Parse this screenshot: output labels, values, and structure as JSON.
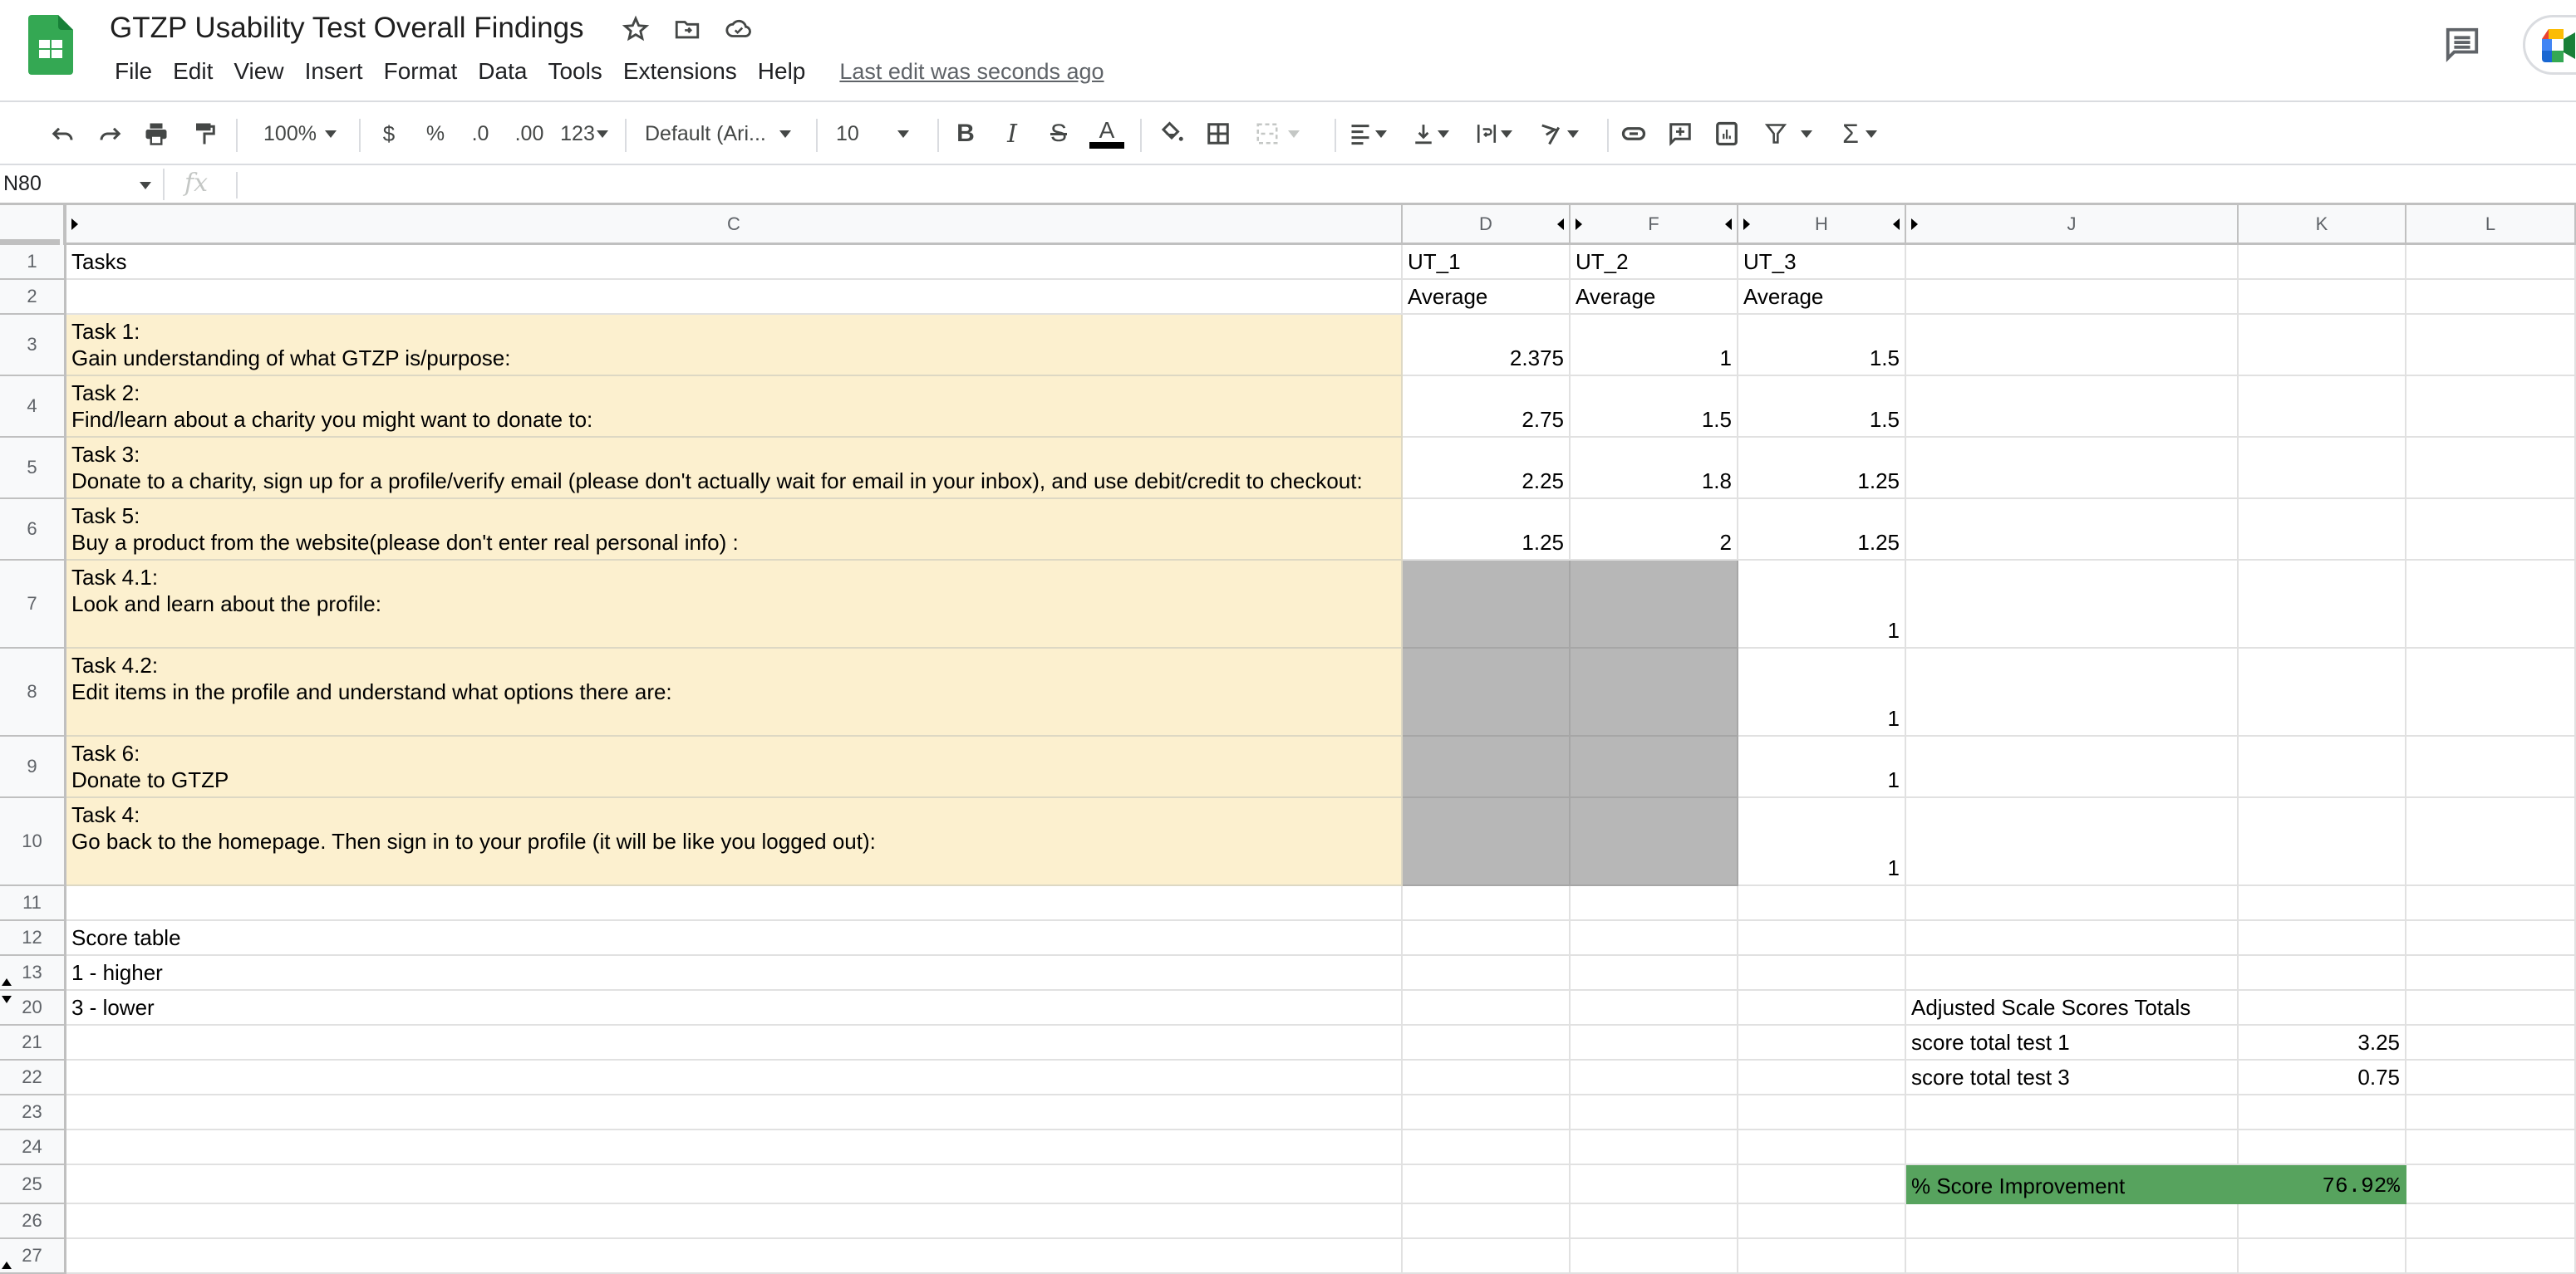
{
  "app": {
    "doc_title": "GTZP Usability Test Overall Findings",
    "brand_color": "#0f9d58",
    "menu": [
      "File",
      "Edit",
      "View",
      "Insert",
      "Format",
      "Data",
      "Tools",
      "Extensions",
      "Help"
    ],
    "last_edit": "Last edit was seconds ago"
  },
  "toolbar": {
    "zoom": "100%",
    "currency": "$",
    "percent": "%",
    "decrease_decimal": ".0",
    "increase_decimal": ".00",
    "more_formats": "123",
    "font": "Default (Ari...",
    "font_size": "10",
    "bold": "B",
    "italic": "I",
    "strikethrough": "S",
    "text_color_label": "A",
    "text_color": "#000000",
    "sum": "Σ"
  },
  "formula_bar": {
    "name_box": "N80",
    "fx": "fx",
    "value": ""
  },
  "columns": [
    "C",
    "D",
    "F",
    "H",
    "J",
    "K",
    "L"
  ],
  "rows": [
    {
      "num": "1",
      "C": "Tasks",
      "D": "UT_1",
      "F": "UT_2",
      "H": "UT_3"
    },
    {
      "num": "2",
      "C": "",
      "D": "Average",
      "F": "Average",
      "H": "Average"
    },
    {
      "num": "3",
      "task": "Task 1:",
      "desc": "Gain understanding of what GTZP is/purpose:",
      "D": "2.375",
      "F": "1",
      "H": "1.5"
    },
    {
      "num": "4",
      "task": "Task 2:",
      "desc": "Find/learn about a charity you might want to donate to:",
      "D": "2.75",
      "F": "1.5",
      "H": "1.5"
    },
    {
      "num": "5",
      "task": "Task 3:",
      "desc": "Donate to a charity, sign up for a profile/verify email (please don't actually wait for email in your inbox), and use debit/credit to checkout:",
      "D": "2.25",
      "F": "1.8",
      "H": "1.25"
    },
    {
      "num": "6",
      "task": "Task 5:",
      "desc": "Buy a product from the website(please don't enter real personal info) :",
      "D": "1.25",
      "F": "2",
      "H": "1.25"
    },
    {
      "num": "7",
      "task": "Task 4.1:",
      "desc": "Look and learn about the profile:",
      "D": "",
      "F": "",
      "H": "1"
    },
    {
      "num": "8",
      "task": "Task 4.2:",
      "desc": "Edit items in the profile and understand what options there are:",
      "D": "",
      "F": "",
      "H": "1"
    },
    {
      "num": "9",
      "task": "Task 6:",
      "desc": "Donate to GTZP",
      "D": "",
      "F": "",
      "H": "1"
    },
    {
      "num": "10",
      "task": "Task 4:",
      "desc": "Go back to the homepage. Then sign in to your profile (it will be like you logged out):",
      "D": "",
      "F": "",
      "H": "1"
    },
    {
      "num": "11",
      "C": ""
    },
    {
      "num": "12",
      "C": "Score table"
    },
    {
      "num": "13",
      "C": "1 - higher"
    },
    {
      "num": "20",
      "C": "3 - lower",
      "J": "Adjusted Scale Scores Totals"
    },
    {
      "num": "21",
      "J": "score total  test 1",
      "K": "3.25"
    },
    {
      "num": "22",
      "J": "score total test 3",
      "K": "0.75"
    },
    {
      "num": "23"
    },
    {
      "num": "24"
    },
    {
      "num": "25",
      "J": "% Score Improvement",
      "K": "76.92%"
    },
    {
      "num": "26"
    },
    {
      "num": "27"
    }
  ],
  "colors": {
    "task_fill": "#fcf0cf",
    "na_fill": "#b7b7b7",
    "highlight_fill": "#57a35e"
  }
}
